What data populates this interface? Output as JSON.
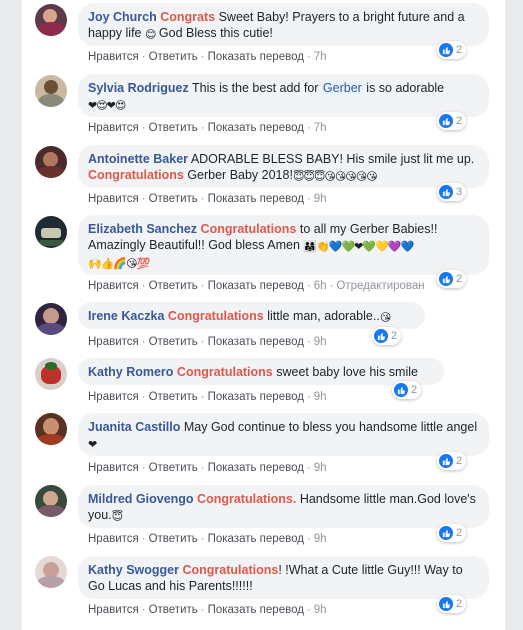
{
  "actions": {
    "like": "Нравится",
    "reply": "Ответить",
    "translate": "Показать перевод",
    "sep": "·",
    "edited": "Отредактирован"
  },
  "colors": {
    "author": "#385898",
    "highlight": "#e0584a",
    "like": "#1877f2",
    "meta": "#90949c"
  },
  "comments": [
    {
      "author": "Joy Church",
      "hl": "Congrats",
      "text": " Sweet Baby! Prayers to a bright future and a happy life ",
      "emoji": "😊",
      "text2": " God Bless this cutie!",
      "time": "7h",
      "likes": "2"
    },
    {
      "author": "Sylvia Rodriguez",
      "text": " This is the best add for ",
      "tag": "Gerber",
      "text2": " is so adorable",
      "emoji": "❤😍❤😍",
      "time": "7h",
      "likes": "2"
    },
    {
      "author": "Antoinette Baker",
      "text": " ADORABLE BLESS BABY! His smile just lit me up. ",
      "hl": "Congratulations",
      "text2": " Gerber Baby 2018!",
      "emoji": "😇😇😇😘😘😘😘😘",
      "time": "9h",
      "likes": "3"
    },
    {
      "author": "Elizabeth Sanchez",
      "hl": "Congratulations",
      "text": " to all my Gerber Babies!! Amazingly Beautiful!! God bless Amen ",
      "emoji": "👨‍👩‍👧👏💙💚❤💚💛💜💙",
      "emoji2": "🙌👍🌈😘💯",
      "time": "6h",
      "edited": true,
      "likes": "2"
    },
    {
      "author": "Irene Kaczka",
      "hl": "Congratulations",
      "text": " little man, adorable..",
      "emoji": "😘",
      "time": "9h",
      "likes": "2"
    },
    {
      "author": "Kathy Romero",
      "hl": "Congratulations",
      "text": " sweet baby love his smile",
      "time": "9h",
      "likes": "2"
    },
    {
      "author": "Juanita Castillo",
      "text": " May God continue to bless you handsome little angel",
      "emoji": "❤",
      "time": "9h",
      "likes": "2"
    },
    {
      "author": "Mildred Giovengo",
      "hl": "Congratulations.",
      "text": " Handsome little man.God love's you.",
      "emoji": "😇",
      "time": "9h",
      "likes": "2"
    },
    {
      "author": "Kathy Swogger",
      "hl": "Congratulations",
      "text": "! !What a Cute little Guy!!! Way to Go Lucas and his Parents!!!!!!",
      "time": "9h",
      "likes": "2"
    }
  ]
}
